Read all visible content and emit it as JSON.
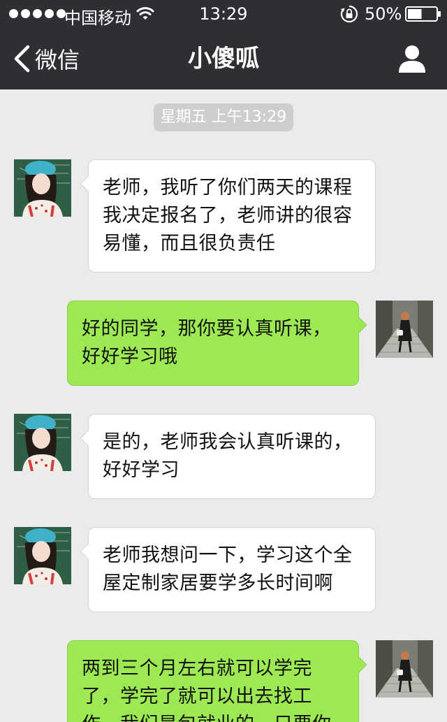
{
  "status_bar": {
    "carrier": "中国移动",
    "time": "13:29",
    "battery_percent": "50%",
    "battery_level": 0.5,
    "signal_bars": 5,
    "icons": [
      "signal-dots-icon",
      "wifi-icon",
      "rotation-lock-icon",
      "battery-icon"
    ]
  },
  "nav": {
    "back_label": "微信",
    "title": "小傻呱",
    "back_icon": "chevron-left-icon",
    "profile_icon": "person-icon"
  },
  "chat": {
    "timestamp": "星期五 上午13:29",
    "messages": [
      {
        "from": "contact",
        "text": "老师，我听了你们两天的课程我决定报名了，老师讲的很容易懂，而且很负责任"
      },
      {
        "from": "me",
        "text": "好的同学，那你要认真听课，好好学习哦"
      },
      {
        "from": "contact",
        "text": "是的，老师我会认真听课的，好好学习"
      },
      {
        "from": "contact",
        "text": "老师我想问一下，学习这个全屋定制家居要学多长时间啊"
      },
      {
        "from": "me",
        "text": "两到三个月左右就可以学完了，学完了就可以出去找工作，我们是包就业的，只要你"
      }
    ]
  },
  "colors": {
    "header_bg": "#2e2e33",
    "chat_bg": "#ebebeb",
    "outgoing_bubble": "#9de954",
    "incoming_bubble": "#ffffff",
    "timestamp_bg": "#cecece"
  }
}
